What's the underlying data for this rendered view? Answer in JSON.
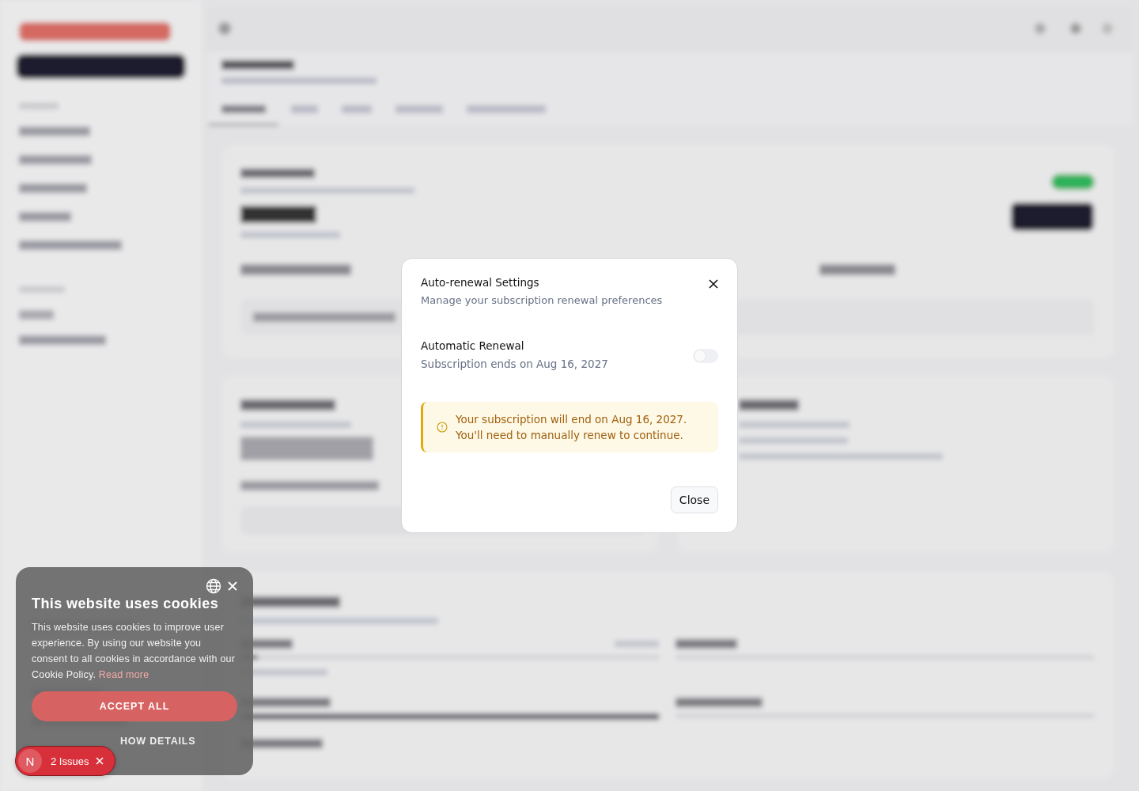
{
  "background": {
    "kind": "blurred"
  },
  "dialog": {
    "title": "Auto-renewal Settings",
    "subtitle": "Manage your subscription renewal preferences",
    "setting": {
      "label": "Automatic Renewal",
      "description": "Subscription ends on Aug 16, 2027",
      "on": false
    },
    "notice": {
      "lines": [
        "Your subscription will end on Aug 16, 2027.",
        "You'll need to manually renew to continue."
      ]
    },
    "button": "Close"
  },
  "cookie_banner": {
    "title": "This website uses cookies",
    "text": "This website uses cookies to improve user experience. By using our website you consent to all cookies in accordance with our Cookie Policy.",
    "link": "Read more",
    "accept": "ACCEPT ALL",
    "details": "HOW DETAILS"
  },
  "issues_badge": {
    "letter": "N",
    "label": "2 Issues"
  }
}
